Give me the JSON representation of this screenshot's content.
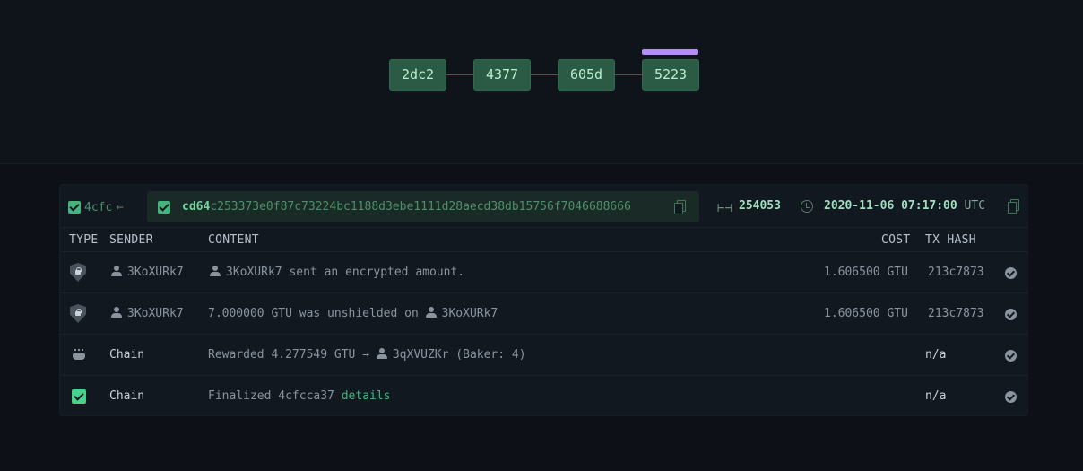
{
  "chain_blocks": [
    {
      "label": "2dc2"
    },
    {
      "label": "4377"
    },
    {
      "label": "605d"
    },
    {
      "label": "5223"
    }
  ],
  "block": {
    "parent_label": "4cfc",
    "hash_prefix": "cd64",
    "hash_rest": "c253373e0f87c73224bc1188d3ebe1111d28aecd38db15756f7046688666",
    "height": "254053",
    "timestamp": "2020-11-06 07:17:00",
    "tz": "UTC"
  },
  "columns": {
    "type": "TYPE",
    "sender": "SENDER",
    "content": "CONTENT",
    "cost": "COST",
    "tx_hash": "TX HASH"
  },
  "rows": [
    {
      "type_icon": "shield-lock-icon",
      "sender": "3KoXURk7",
      "content_account": "3KoXURk7",
      "content_text": " sent an encrypted amount.",
      "cost": "1.606500 GTU",
      "tx_hash": "213c7873"
    },
    {
      "type_icon": "shield-lock-icon",
      "sender": "3KoXURk7",
      "content_text": "7.000000 GTU was unshielded on ",
      "content_account": "3KoXURk7",
      "cost": "1.606500 GTU",
      "tx_hash": "213c7873"
    },
    {
      "type_icon": "baker-icon",
      "sender": "Chain",
      "content_text": "Rewarded 4.277549 GTU → ",
      "content_account": "3qXVUZKr",
      "content_suffix": " (Baker: 4)",
      "tx_hash": "n/a"
    },
    {
      "type_icon": "finalized-check-icon",
      "sender": "Chain",
      "content_text": "Finalized 4cfcca37 ",
      "content_link": "details",
      "tx_hash": "n/a"
    }
  ],
  "colors": {
    "background": "#0d1117",
    "accent_green": "#46b47d",
    "block_fill": "#2b5b45",
    "marker_purple": "#b58cf0"
  }
}
